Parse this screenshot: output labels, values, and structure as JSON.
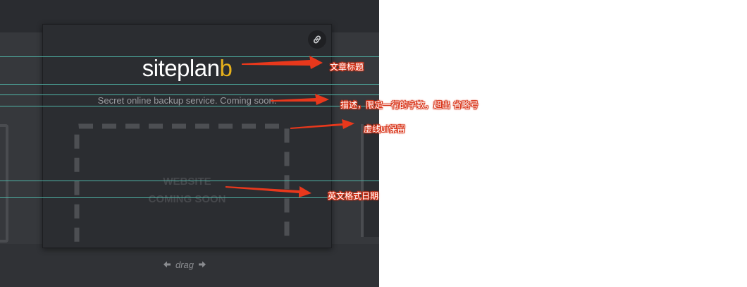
{
  "brand": {
    "name_main": "siteplan",
    "name_accent": "b",
    "accent_color": "#e8b21b"
  },
  "card": {
    "tagline": "Secret online backup service. Coming soon.",
    "placeholder_line1": "WEBSITE",
    "placeholder_line2": "COMING SOON",
    "link_icon": "link-icon"
  },
  "drag": {
    "label": "drag",
    "left_icon": "arrow-left-icon",
    "right_icon": "arrow-right-icon"
  },
  "annotations": {
    "title": "文章标题",
    "description": "描述，限定一行的字数，超出 省略号",
    "dashed_ui": "虚线ui保留",
    "date": "英文格式日期"
  },
  "colors": {
    "guide_line": "#4fb3a6",
    "annotation_arrow": "#e8381c",
    "background": "#303236"
  }
}
